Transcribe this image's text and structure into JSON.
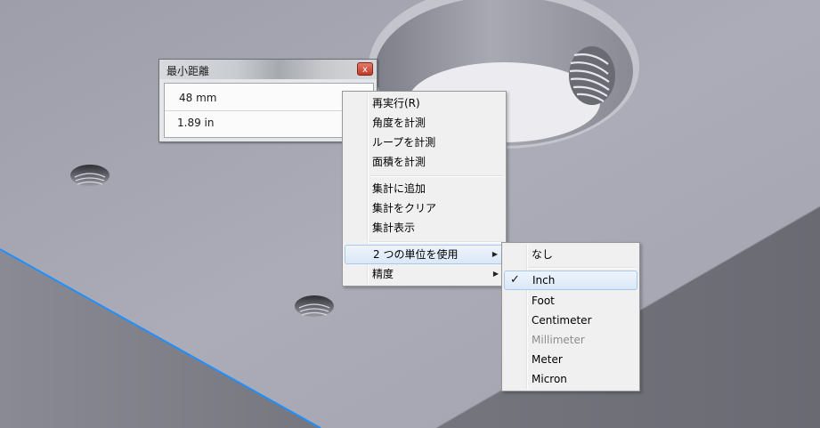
{
  "dialog": {
    "title": "最小距離",
    "close_glyph": "x",
    "value_mm": "48 mm",
    "value_in": "1.89 in"
  },
  "context_menu": {
    "items": [
      {
        "label": "再実行(R)"
      },
      {
        "label": "角度を計測"
      },
      {
        "label": "ループを計測"
      },
      {
        "label": "面積を計測"
      },
      {
        "label": "集計に追加"
      },
      {
        "label": "集計をクリア"
      },
      {
        "label": "集計表示"
      },
      {
        "label": "2 つの単位を使用",
        "submenu": true,
        "highlighted": true
      },
      {
        "label": "精度",
        "submenu": true
      }
    ],
    "submenu_arrow": "▶"
  },
  "units_submenu": {
    "items": [
      {
        "label": "なし"
      },
      {
        "label": "Inch",
        "checked": true,
        "highlighted": true
      },
      {
        "label": "Foot"
      },
      {
        "label": "Centimeter"
      },
      {
        "label": "Millimeter",
        "disabled": true
      },
      {
        "label": "Meter"
      },
      {
        "label": "Micron"
      }
    ],
    "check_glyph": "✓"
  },
  "colors": {
    "model_top": "#a9a9b5",
    "model_side": "#6f6f78",
    "edge_highlight": "#1e90ff",
    "menu_bg": "#f0f0f0",
    "highlight_border": "#a8c8ec"
  }
}
